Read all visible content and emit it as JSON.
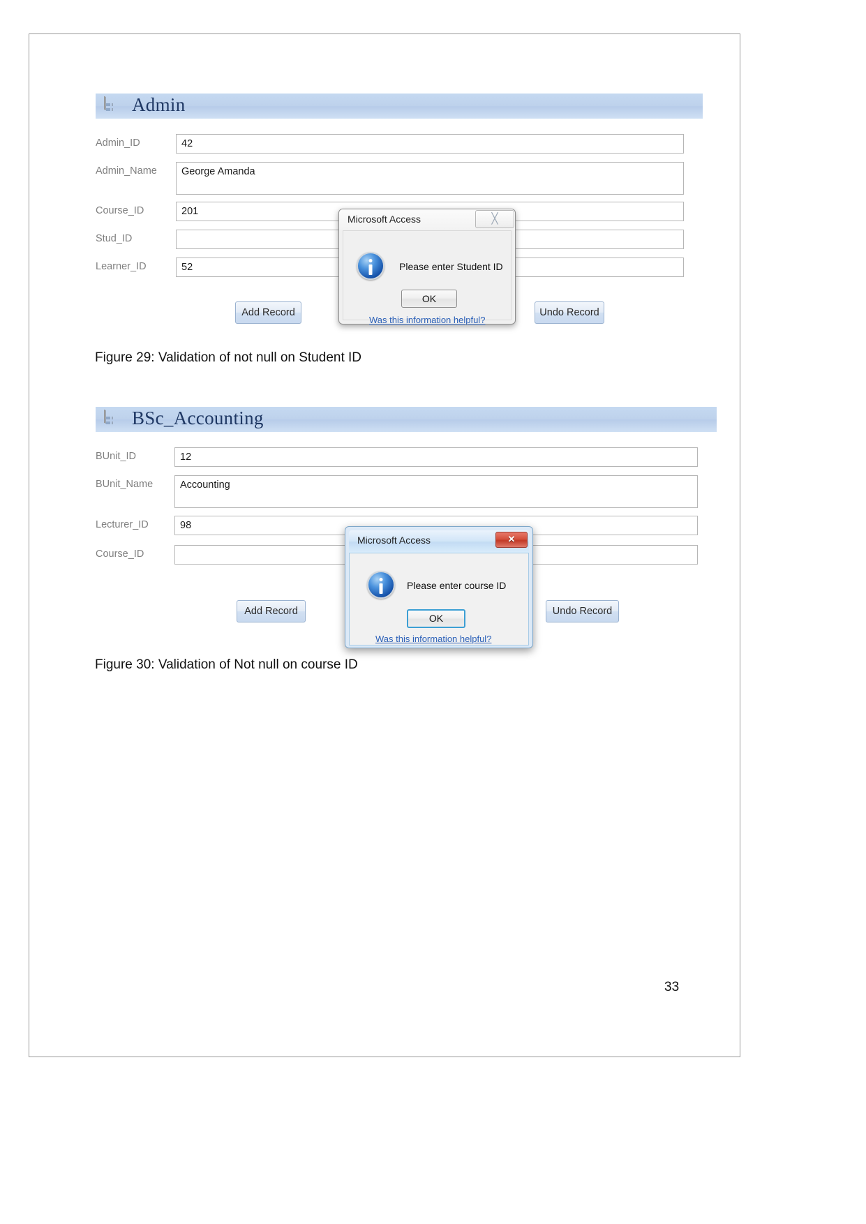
{
  "page": {
    "number": "33"
  },
  "figures": [
    {
      "caption": "Figure 29: Validation of not null on Student ID",
      "form": {
        "icon": "access-form-icon",
        "title": "Admin",
        "fields": [
          {
            "label": "Admin_ID",
            "value": "42"
          },
          {
            "label": "Admin_Name",
            "value": "George Amanda"
          },
          {
            "label": "Course_ID",
            "value": "201"
          },
          {
            "label": "Stud_ID",
            "value": ""
          },
          {
            "label": "Learner_ID",
            "value": "52"
          }
        ],
        "buttons": {
          "add": "Add Record",
          "undo": "Undo Record"
        }
      },
      "dialog": {
        "title": "Microsoft Access",
        "close_glyph": "╳",
        "icon": "information-icon",
        "message": "Please enter Student ID",
        "ok_label": "OK",
        "link_label": "Was this information helpful?"
      }
    },
    {
      "caption": "Figure 30: Validation of Not null on course ID",
      "form": {
        "icon": "access-form-icon",
        "title": "BSc_Accounting",
        "fields": [
          {
            "label": "BUnit_ID",
            "value": "12"
          },
          {
            "label": "BUnit_Name",
            "value": "Accounting"
          },
          {
            "label": "Lecturer_ID",
            "value": "98"
          },
          {
            "label": "Course_ID",
            "value": ""
          }
        ],
        "buttons": {
          "add": "Add Record",
          "undo": "Undo Record"
        }
      },
      "dialog": {
        "title": "Microsoft Access",
        "close_glyph": "✕",
        "icon": "information-icon",
        "message": "Please enter course ID",
        "ok_label": "OK",
        "link_label": "Was this information helpful?"
      }
    }
  ],
  "colors": {
    "form_header": "#c5d9f1",
    "form_title_text": "#1f3864",
    "field_label": "#808080",
    "link": "#2b60b8",
    "close_red": "#c23a27"
  }
}
